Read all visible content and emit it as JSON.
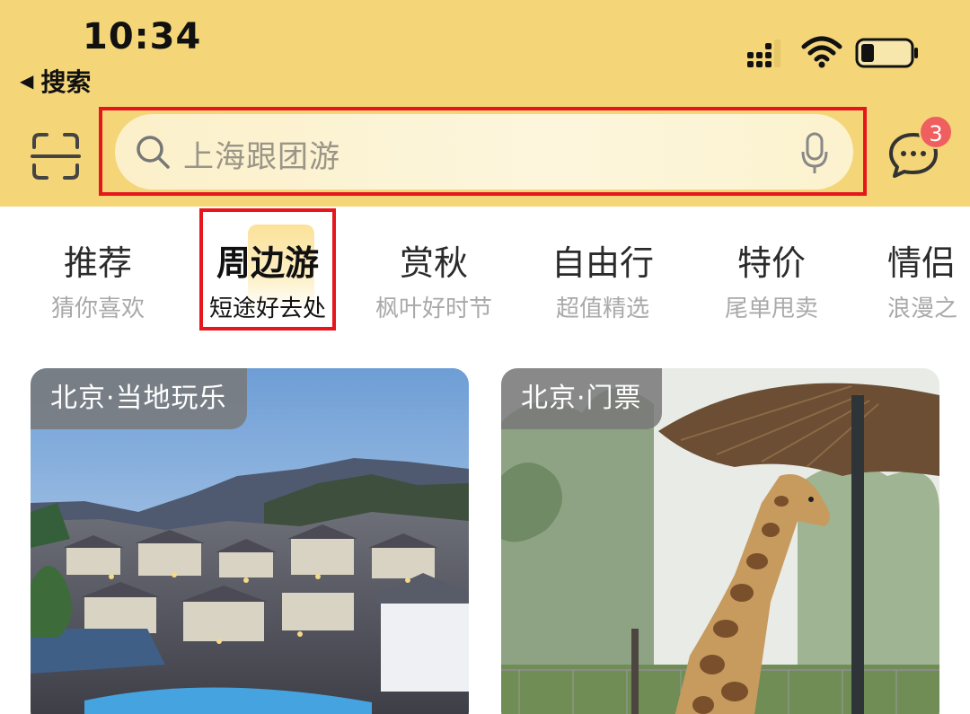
{
  "status_bar": {
    "time": "10:34",
    "back_label": "搜索"
  },
  "search": {
    "placeholder": "上海跟团游"
  },
  "messages": {
    "badge_count": "3"
  },
  "tabs": [
    {
      "title": "推荐",
      "subtitle": "猜你喜欢",
      "active": false
    },
    {
      "title": "周边游",
      "subtitle": "短途好去处",
      "active": true
    },
    {
      "title": "赏秋",
      "subtitle": "枫叶好时节",
      "active": false
    },
    {
      "title": "自由行",
      "subtitle": "超值精选",
      "active": false
    },
    {
      "title": "特价",
      "subtitle": "尾单甩卖",
      "active": false
    },
    {
      "title": "情侣",
      "subtitle": "浪漫之",
      "active": false
    }
  ],
  "cards": [
    {
      "tag": "北京·当地玩乐",
      "image": "water-town-night-photo"
    },
    {
      "tag": "北京·门票",
      "image": "giraffe-zoo-photo"
    }
  ],
  "colors": {
    "header_bg": "#f4d679",
    "highlight_outline": "#e5171d",
    "badge": "#ef5f5f"
  }
}
